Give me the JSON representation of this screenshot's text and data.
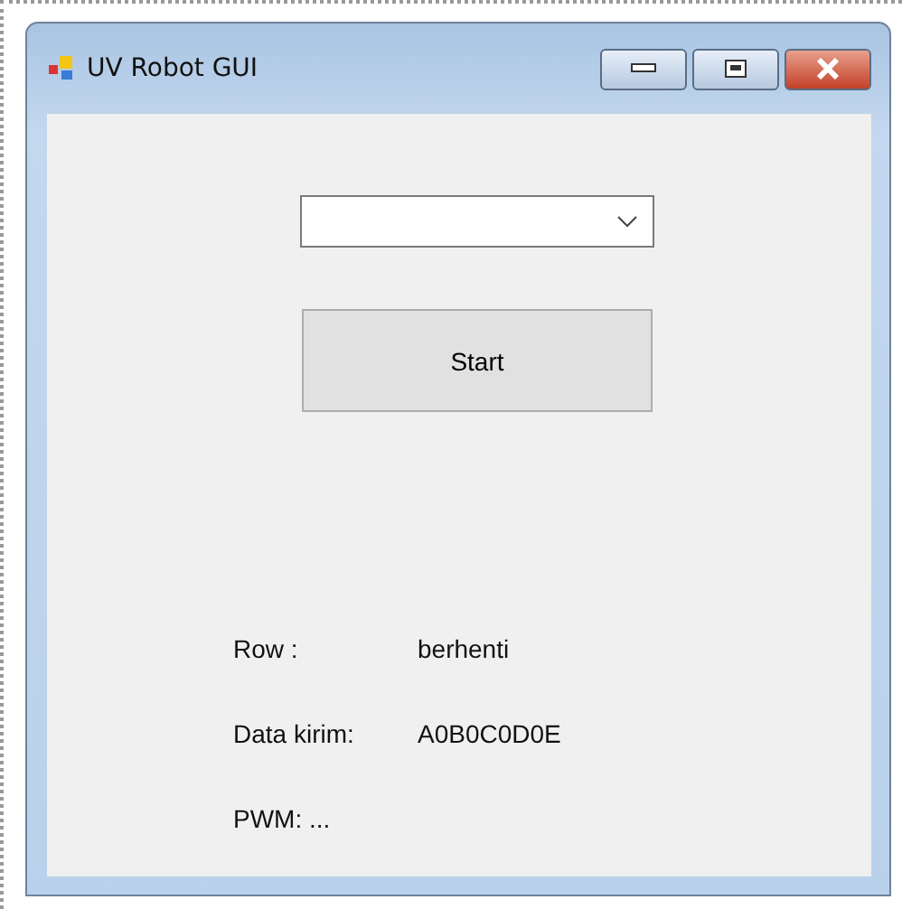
{
  "window": {
    "title": "UV Robot GUI"
  },
  "start_button": {
    "label": "Start"
  },
  "labels": [
    {
      "label": "Row :",
      "value": "berhenti"
    },
    {
      "label": "Data kirim:",
      "value": "A0B0C0D0E"
    },
    {
      "label": "PWM: ..."
    }
  ]
}
